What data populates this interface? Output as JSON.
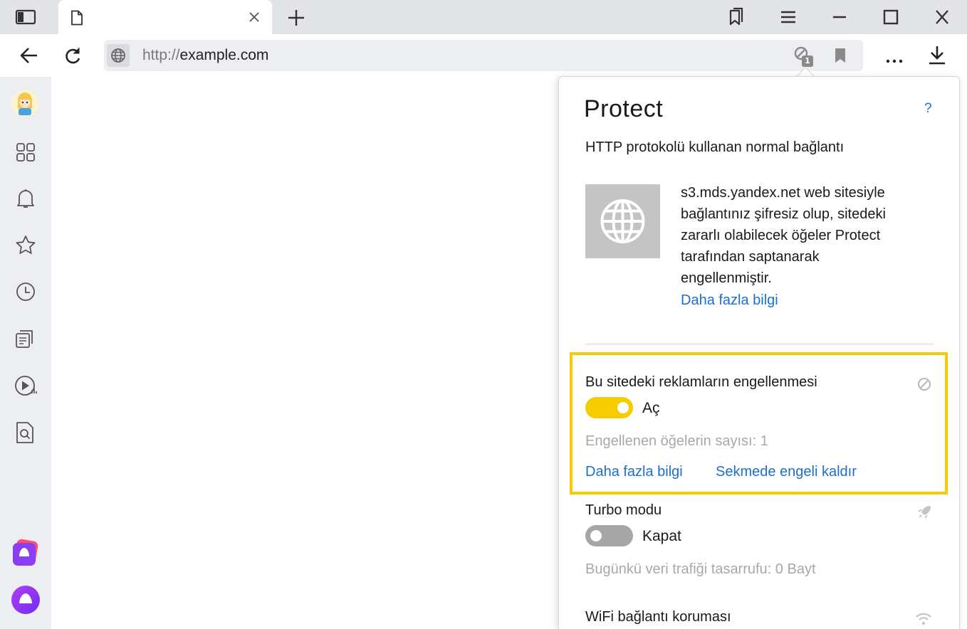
{
  "browser": {
    "tab": {
      "title": ""
    },
    "address_bar": {
      "url_prefix": "http://",
      "url_host": "example.com",
      "blocked_count": "1"
    }
  },
  "protect_panel": {
    "title": "Protect",
    "help": "?",
    "connection_title": "HTTP protokolü kullanan normal bağlantı",
    "description_lines": [
      "s3.mds.yandex.net web sitesiyle",
      "bağlantınız şifresiz olup, sitedeki",
      "zararlı olabilecek öğeler Protect",
      "tarafından saptanarak",
      "engellenmiştir."
    ],
    "more_info": "Daha fazla bilgi",
    "ad_block": {
      "title": "Bu sitedeki reklamların engellenmesi",
      "toggle_state": "on",
      "toggle_label": "Aç",
      "blocked_items": "Engellenen öğelerin sayısı: 1",
      "more_info": "Daha fazla bilgi",
      "unblock": "Sekmede engeli kaldır"
    },
    "turbo": {
      "title": "Turbo modu",
      "toggle_state": "off",
      "toggle_label": "Kapat",
      "savings": "Bugünkü veri trafiği tasarrufu: 0 Bayt"
    },
    "wifi": {
      "title": "WiFi bağlantı koruması"
    }
  },
  "colors": {
    "accent_yellow": "#f5cc00",
    "link_blue": "#1a6fd0",
    "toggle_off": "#a6a6a6"
  }
}
